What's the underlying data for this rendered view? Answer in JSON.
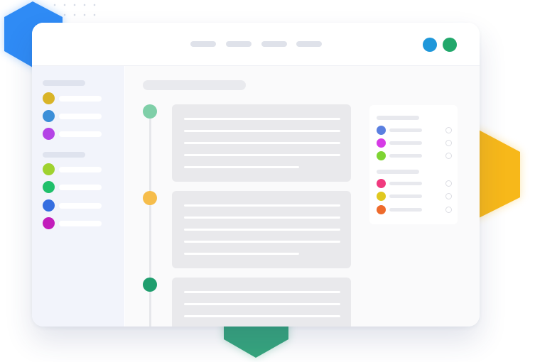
{
  "decor": {
    "blue_hex_color": "#2f8bf5",
    "yellow_hex_color": "#f7b81a",
    "green_hex_color": "#36a57d",
    "dots_color": "#d6dbe6"
  },
  "window": {
    "nav_items": [
      "",
      "",
      "",
      ""
    ],
    "controls": [
      {
        "name": "blue-control",
        "color": "#1f97da"
      },
      {
        "name": "green-control",
        "color": "#22a86b"
      }
    ]
  },
  "sidebar": {
    "groups": [
      {
        "heading": "",
        "items": [
          {
            "label": "",
            "color": "#d9b427"
          },
          {
            "label": "",
            "color": "#3c8fd8"
          },
          {
            "label": "",
            "color": "#b443e6"
          }
        ]
      },
      {
        "heading": "",
        "items": [
          {
            "label": "",
            "color": "#9fd22f"
          },
          {
            "label": "",
            "color": "#20c06b"
          },
          {
            "label": "",
            "color": "#356ee0"
          },
          {
            "label": "",
            "color": "#c21dbb"
          }
        ]
      }
    ]
  },
  "main": {
    "title": "",
    "timeline": [
      {
        "dot_color": "#7fcfa8",
        "lines": 5
      },
      {
        "dot_color": "#f6bd4b",
        "lines": 5
      },
      {
        "dot_color": "#1f9e6e",
        "lines": 3
      }
    ]
  },
  "filter_panel": {
    "groups": [
      {
        "heading": "",
        "items": [
          {
            "label": "",
            "color": "#5a7fe0",
            "selected": false
          },
          {
            "label": "",
            "color": "#d63be6",
            "selected": false
          },
          {
            "label": "",
            "color": "#7ed432",
            "selected": false
          }
        ]
      },
      {
        "heading": "",
        "items": [
          {
            "label": "",
            "color": "#f03a7e",
            "selected": false
          },
          {
            "label": "",
            "color": "#e0c81f",
            "selected": false
          },
          {
            "label": "",
            "color": "#ee6b2c",
            "selected": false
          }
        ]
      }
    ]
  }
}
